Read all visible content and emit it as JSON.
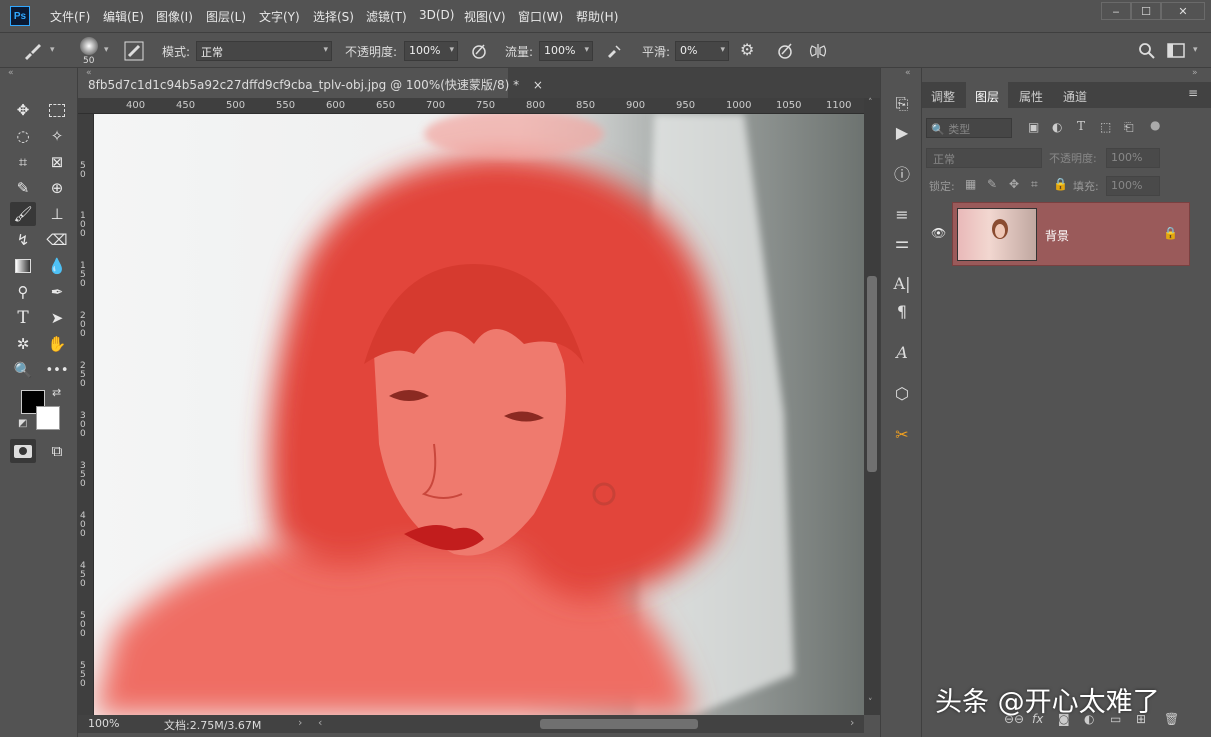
{
  "app": {
    "logo": "Ps"
  },
  "menu": [
    "文件(F)",
    "编辑(E)",
    "图像(I)",
    "图层(L)",
    "文字(Y)",
    "选择(S)",
    "滤镜(T)",
    "3D(D)",
    "视图(V)",
    "窗口(W)",
    "帮助(H)"
  ],
  "options": {
    "brush_size": "50",
    "mode_label": "模式:",
    "mode_value": "正常",
    "opacity_label": "不透明度:",
    "opacity_value": "100%",
    "flow_label": "流量:",
    "flow_value": "100%",
    "smooth_label": "平滑:",
    "smooth_value": "0%"
  },
  "document": {
    "tab_title": "8fb5d7c1d1c94b5a92c27dffd9cf9cba_tplv-obj.jpg @ 100%(快速蒙版/8) *",
    "close": "×"
  },
  "ruler": {
    "top": [
      "400",
      "450",
      "500",
      "550",
      "600",
      "650",
      "700",
      "750",
      "800",
      "850",
      "900",
      "950",
      "1000",
      "1050",
      "1100"
    ],
    "left": [
      "50",
      "100",
      "150",
      "200",
      "250",
      "300",
      "350",
      "400",
      "450",
      "500",
      "550",
      "600"
    ]
  },
  "status": {
    "zoom": "100%",
    "doc_info": "文档:2.75M/3.67M"
  },
  "panel": {
    "tabs": [
      "调整",
      "图层",
      "属性",
      "通道"
    ],
    "filter_placeholder": "类型",
    "blend_mode": "正常",
    "opacity_label": "不透明度:",
    "opacity_value": "100%",
    "lock_label": "锁定:",
    "fill_label": "填充:",
    "fill_value": "100%",
    "layer_name": "背景"
  },
  "watermark": "头条 @开心太难了",
  "colors": {
    "mask": "#e8473c",
    "accent": "#31a8ff",
    "layer_selected": "#9a5a5a"
  }
}
